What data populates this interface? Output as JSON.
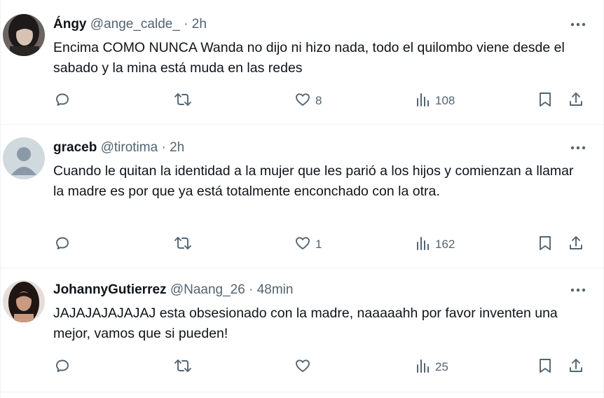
{
  "tweets": [
    {
      "name": "Ángy",
      "handle": "@ange_calde_",
      "separator": "·",
      "time": "2h",
      "text": "Encima COMO NUNCA Wanda no dijo ni hizo nada, todo el quilombo viene desde el sabado y la mina está muda en las redes",
      "likes": "8",
      "views": "108",
      "avatar": "photo-woman-dark-hair"
    },
    {
      "name": "graceb",
      "handle": "@tirotima",
      "separator": "·",
      "time": "2h",
      "text": "Cuando le quitan la identidad a la mujer que les parió a los hijos y comienzan a llamar la madre es por que ya está totalmente enconchado con la otra.",
      "likes": "1",
      "views": "162",
      "avatar": "default-profile-silhouette"
    },
    {
      "name": "JohannyGutierrez",
      "handle": "@Naang_26",
      "separator": "·",
      "time": "48min",
      "text": "JAJAJAJAJAJAJ esta obsesionado con la madre, naaaaahh por favor inventen una mejor, vamos que si pueden!",
      "likes": "",
      "views": "25",
      "avatar": "photo-woman-long-hair"
    }
  ],
  "icons": {
    "reply": "reply-icon",
    "retweet": "retweet-icon",
    "like": "heart-icon",
    "views": "views-icon",
    "bookmark": "bookmark-icon",
    "share": "share-icon",
    "more": "more-icon"
  },
  "colors": {
    "text": "#0f1419",
    "secondary": "#536471",
    "border": "#eff3f4"
  }
}
